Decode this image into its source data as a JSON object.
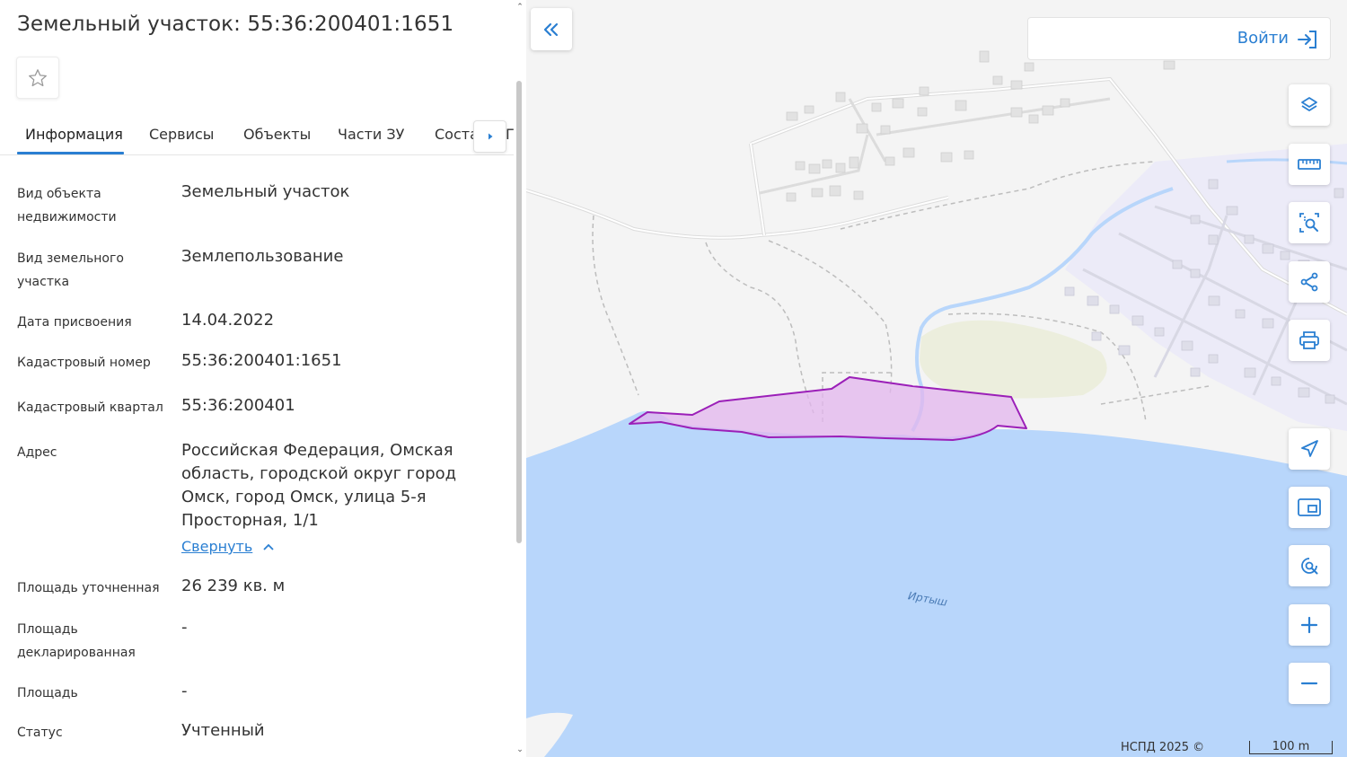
{
  "panel": {
    "title": "Земельный участок: 55:36:200401:1651",
    "favorite_icon": "star-outline-icon",
    "tabs": [
      {
        "label": "Информация",
        "active": true
      },
      {
        "label": "Сервисы"
      },
      {
        "label": "Объекты"
      },
      {
        "label": "Части ЗУ"
      },
      {
        "label": "Соста"
      }
    ],
    "tabs_overflow_char": "Г",
    "tabs_scroll_icon": "caret-right-icon",
    "rows": [
      {
        "label": "Вид объекта недвижимости",
        "value": "Земельный участок"
      },
      {
        "label": "Вид земельного участка",
        "value": "Землепользование"
      },
      {
        "label": "Дата присвоения",
        "value": "14.04.2022"
      },
      {
        "label": "Кадастровый номер",
        "value": "55:36:200401:1651"
      },
      {
        "label": "Кадастровый квартал",
        "value": "55:36:200401"
      },
      {
        "label": "Адрес",
        "value": "Российская Федерация, Омская область, городской округ город Омск, город Омск, улица 5-я Просторная, 1/1"
      },
      {
        "label": "Площадь уточненная",
        "value": "26 239 кв. м"
      },
      {
        "label": "Площадь декларированная",
        "value": "-"
      },
      {
        "label": "Площадь",
        "value": "-"
      },
      {
        "label": "Статус",
        "value": "Учтенный"
      }
    ],
    "collapse_label": "Свернуть",
    "collapse_icon": "chevron-up-icon",
    "scroll_up_glyph": "⌃",
    "scroll_down_glyph": "⌄"
  },
  "map": {
    "collapse_panel_icon": "double-chevron-left-icon",
    "login_label": "Войти",
    "login_icon": "sign-in-icon",
    "tools": [
      {
        "name": "layers",
        "icon": "layers-icon"
      },
      {
        "name": "measure",
        "icon": "ruler-icon"
      },
      {
        "name": "select-area",
        "icon": "area-search-icon"
      },
      {
        "name": "share",
        "icon": "share-icon"
      },
      {
        "name": "print",
        "icon": "printer-icon"
      },
      {
        "name": "locate",
        "icon": "location-arrow-icon"
      },
      {
        "name": "minimap",
        "icon": "minimap-icon"
      },
      {
        "name": "search-map",
        "icon": "map-search-icon"
      },
      {
        "name": "zoom-in",
        "icon": "plus-icon"
      },
      {
        "name": "zoom-out",
        "icon": "minus-icon"
      }
    ],
    "river_label": "Иртыш",
    "copyright": "НСПД 2025 ©",
    "scale_label": "100 m",
    "colors": {
      "accent": "#2a7fd2",
      "water": "#b8d6fb",
      "parcel_stroke": "#9b1fb8",
      "parcel_fill": "#e3b6ee"
    }
  }
}
